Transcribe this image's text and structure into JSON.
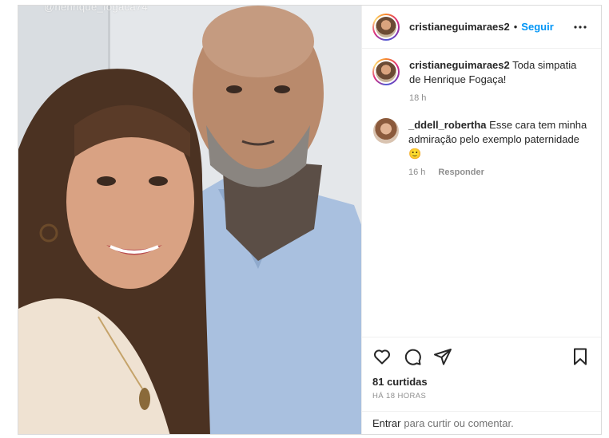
{
  "photo": {
    "watermark": "@henrique_fogaca74"
  },
  "header": {
    "username": "cristianeguimaraes2",
    "separator": "•",
    "follow_label": "Seguir",
    "more_icon": "more-horizontal-icon"
  },
  "caption": {
    "username": "cristianeguimaraes2",
    "text": "Toda simpatia de Henrique Fogaça!",
    "time": "18 h"
  },
  "comments": [
    {
      "username": "_ddell_robertha",
      "text": "Esse cara tem minha admiração pelo exemplo paternidade 🙂",
      "time": "16 h",
      "reply_label": "Responder"
    }
  ],
  "actions": {
    "like_icon": "heart-icon",
    "comment_icon": "comment-icon",
    "share_icon": "share-icon",
    "save_icon": "bookmark-icon"
  },
  "likes_label": "81 curtidas",
  "timestamp": "HÁ 18 HORAS",
  "login": {
    "link": "Entrar",
    "rest": "para curtir ou comentar."
  },
  "colors": {
    "accent": "#0095f6",
    "border": "#dbdbdb",
    "text": "#262626",
    "muted": "#8e8e8e"
  }
}
